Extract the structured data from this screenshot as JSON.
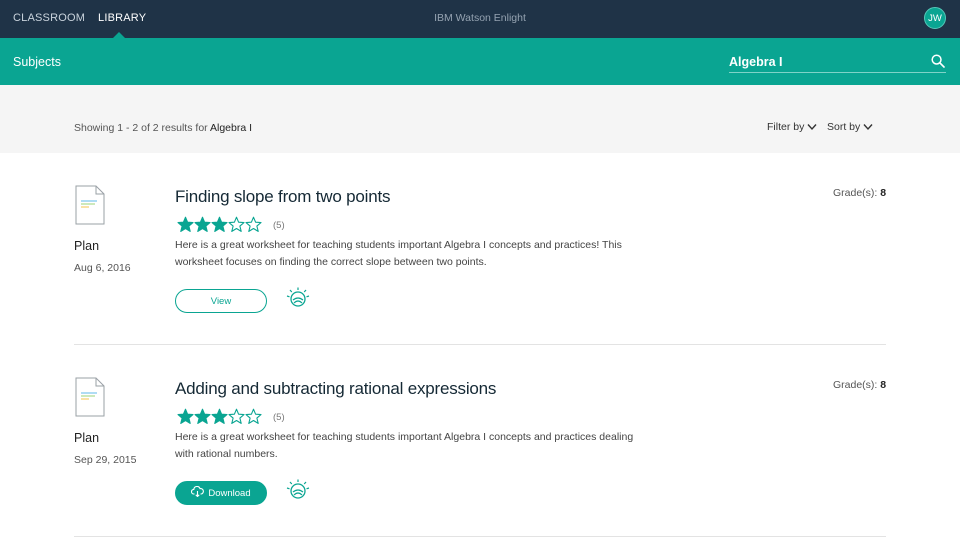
{
  "topbar": {
    "nav": [
      {
        "label": "CLASSROOM",
        "active": false
      },
      {
        "label": "LIBRARY",
        "active": true
      }
    ],
    "brand": "IBM Watson Enlight",
    "avatar_initials": "JW"
  },
  "subjectbar": {
    "label": "Subjects",
    "search_value": "Algebra I",
    "search_icon": "search-icon"
  },
  "results": {
    "showing_prefix": "Showing 1 - 2 of 2 results for",
    "query": "Algebra I",
    "filter_label": "Filter by",
    "sort_label": "Sort by"
  },
  "cards": [
    {
      "type": "Plan",
      "date": "Aug 6, 2016",
      "title": "Finding slope from two points",
      "rating": 3,
      "rating_max": 5,
      "rating_count": "(5)",
      "description": "Here is a great worksheet for teaching students important Algebra I concepts and practices! This worksheet focuses on finding the correct slope between two points.",
      "grade_label": "Grade(s):",
      "grade_value": "8",
      "action_label": "View",
      "action_type": "view"
    },
    {
      "type": "Plan",
      "date": "Sep 29, 2015",
      "title": "Adding and subtracting rational expressions",
      "rating": 3,
      "rating_max": 5,
      "rating_count": "(5)",
      "description": "Here is a great worksheet for teaching students important Algebra I concepts and practices dealing with rational numbers.",
      "grade_label": "Grade(s):",
      "grade_value": "8",
      "action_label": "Download",
      "action_type": "download"
    }
  ],
  "colors": {
    "topbar": "#1f3347",
    "accent": "#0aa592",
    "results_bg": "#f5f5f5"
  }
}
